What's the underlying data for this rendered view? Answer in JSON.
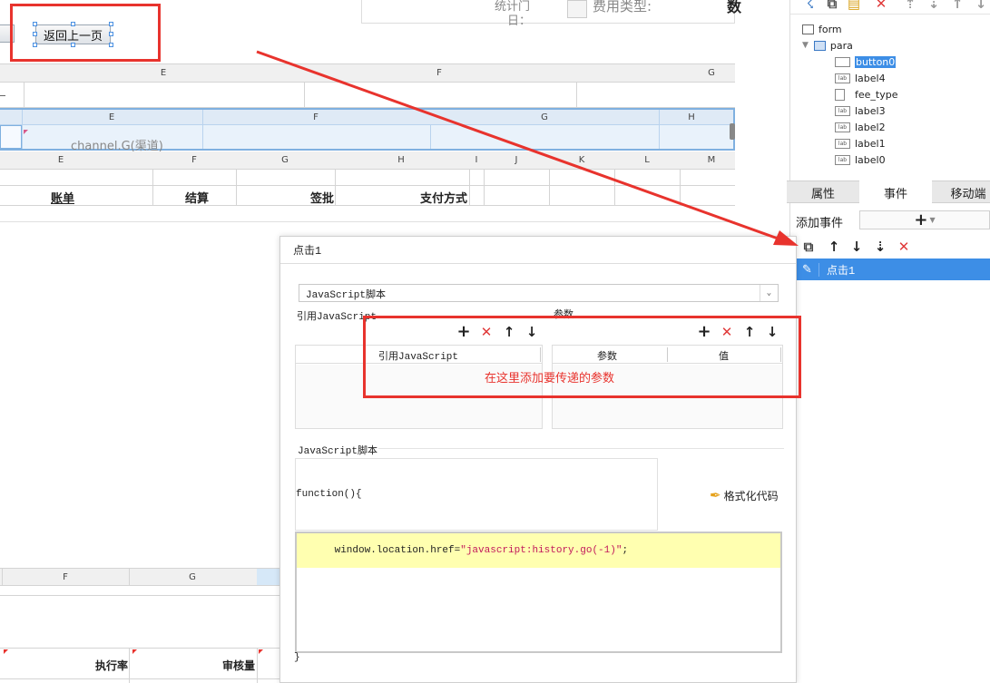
{
  "top": {
    "back_button": "返回上一页",
    "partial_label_1": "统计门",
    "partial_label_1b": "日：",
    "fee_type_label": "费用类型:",
    "partial_right": "数"
  },
  "grid1": {
    "cols": [
      "E",
      "F",
      "G"
    ]
  },
  "grid2": {
    "cols": [
      "E",
      "F",
      "G",
      "H"
    ],
    "cell": "channel.G(渠道)"
  },
  "grid3": {
    "cols": [
      "E",
      "F",
      "G",
      "H",
      "I",
      "J",
      "K",
      "L",
      "M"
    ],
    "cells": {
      "bill": "账单",
      "settle": "结算",
      "approve": "签批",
      "pay": "支付方式"
    }
  },
  "grid4": {
    "cols": [
      "F",
      "G"
    ],
    "cells": {
      "rate": "执行率",
      "audit": "审核量"
    }
  },
  "tree": {
    "items": [
      {
        "label": "form",
        "icon": "form-icon"
      },
      {
        "label": "para",
        "icon": "para-icon"
      },
      {
        "label": "button0",
        "icon": "button-icon"
      },
      {
        "label": "label4",
        "icon": "label-icon"
      },
      {
        "label": "fee_type",
        "icon": "combo-icon"
      },
      {
        "label": "label3",
        "icon": "label-icon"
      },
      {
        "label": "label2",
        "icon": "label-icon"
      },
      {
        "label": "label1",
        "icon": "label-icon"
      },
      {
        "label": "label0",
        "icon": "label-icon"
      }
    ],
    "icon_text": "lab"
  },
  "panel_tabs": {
    "props": "属性",
    "events": "事件",
    "mobile": "移动端"
  },
  "add_event": {
    "label": "添加事件",
    "plus": "+"
  },
  "event_list": {
    "selected": "点击1"
  },
  "dialog": {
    "title": "点击1",
    "type_select": "JavaScript脚本",
    "ref_js_label": "引用JavaScript",
    "params_label": "参数",
    "ref_table_header": "引用JavaScript",
    "param_header": "参数",
    "value_header": "值",
    "hint": "在这里添加要传递的参数",
    "script_label": "JavaScript脚本",
    "function_sig": "function(){",
    "format_code": "格式化代码",
    "code_prefix": "window.location.href=",
    "code_string": "\"javascript:history.go(-1)\"",
    "code_suffix": ";",
    "closing_brace": "}"
  },
  "colors": {
    "annotation_red": "#e8332d",
    "selection_blue": "#3d8ee6",
    "highlight_yellow": "#ffffb0"
  }
}
